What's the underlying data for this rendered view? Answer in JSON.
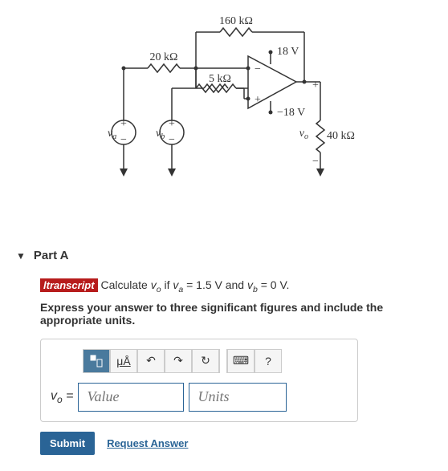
{
  "circuit": {
    "r1": "160 kΩ",
    "r2": "20 kΩ",
    "r3": "5 kΩ",
    "r4": "40 kΩ",
    "vpos": "18 V",
    "vneg": "−18 V",
    "va": "vₐ",
    "vb": "v_b",
    "vo": "vₒ"
  },
  "part": {
    "label": "Part A"
  },
  "question": {
    "transcript_tag": "ltranscript",
    "prompt_prefix": "Calculate ",
    "prompt_var1": "vₒ",
    "prompt_mid1": " if ",
    "prompt_var2": "vₐ",
    "prompt_mid2": " = 1.5 V and ",
    "prompt_var3": "v_b",
    "prompt_end": " = 0 V.",
    "instruction": "Express your answer to three significant figures and include the appropriate units."
  },
  "toolbar": {
    "templates": "⬚",
    "special": "μÅ",
    "undo": "↶",
    "redo": "↷",
    "reset": "↻",
    "keyboard": "⌨",
    "help": "?"
  },
  "inputs": {
    "vo_label": "vₒ = ",
    "value_placeholder": "Value",
    "units_placeholder": "Units"
  },
  "actions": {
    "submit": "Submit",
    "request": "Request Answer"
  }
}
